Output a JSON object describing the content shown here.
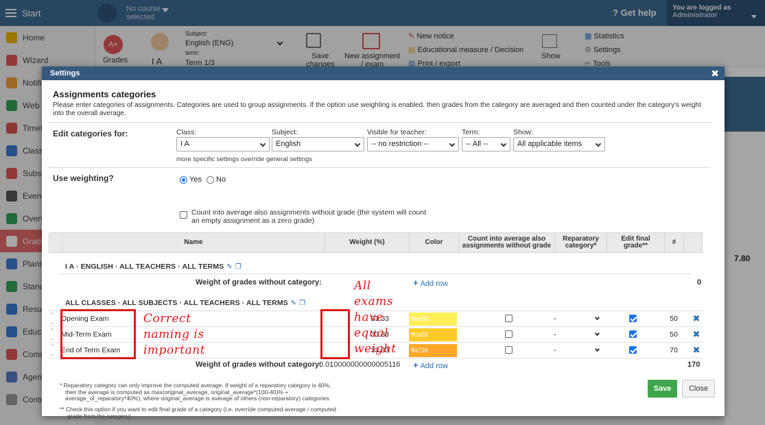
{
  "topbar": {
    "start": "Start",
    "course_line1": "No course",
    "course_line2": "selected",
    "get_help": "Get help",
    "logged_line1": "You are logged as",
    "logged_line2": "Administrator"
  },
  "sidebar": {
    "items": [
      {
        "label": "Home",
        "color": "#f2b400"
      },
      {
        "label": "Wizard",
        "color": "#e05757"
      },
      {
        "label": "Notifi",
        "color": "#f2a13a"
      },
      {
        "label": "Web p",
        "color": "#35a35a"
      },
      {
        "label": "Timeta",
        "color": "#d9534f"
      },
      {
        "label": "Class",
        "color": "#3a7bd5"
      },
      {
        "label": "Substi",
        "color": "#e05757"
      },
      {
        "label": "Event",
        "color": "#555555"
      },
      {
        "label": "Overv",
        "color": "#35a35a"
      },
      {
        "label": "Grade",
        "color": "#ffffff"
      },
      {
        "label": "Plans",
        "color": "#3a7bd5"
      },
      {
        "label": "Stand",
        "color": "#35a35a"
      },
      {
        "label": "Resul",
        "color": "#3a7bd5"
      },
      {
        "label": "Educa",
        "color": "#3a7bd5"
      },
      {
        "label": "Comm",
        "color": "#e05757"
      },
      {
        "label": "Agen",
        "color": "#5a78c8"
      },
      {
        "label": "Contr",
        "color": "#999999"
      }
    ]
  },
  "toolbar": {
    "grades": "Grades",
    "subject_label": "Subject:",
    "subject_value": "English (ENG)",
    "term_label": "term:",
    "class_short": "I A",
    "term_value": "Term 1/3",
    "save_line1": "Save",
    "save_line2": "changes",
    "new_assignment_line1": "New assignment",
    "new_assignment_line2": "/ exam",
    "new_notice": "New notice",
    "educational_measure": "Educational measure / Decision",
    "print_export": "Print / export",
    "show": "Show",
    "statistics": "Statistics",
    "settings": "Settings",
    "tools": "Tools"
  },
  "background": {
    "value_780": "7.80"
  },
  "dialog": {
    "title": "Settings",
    "section_title": "Assignments categories",
    "description": "Please enter categories of assignments. Categories are used to group assignments. If the option use weighting is enabled, then grades from the category are averaged and then counted under the category's weight into the overall average.",
    "edit_for": "Edit categories for:",
    "filters": {
      "class_label": "Class:",
      "class_value": "I A",
      "subject_label": "Subject:",
      "subject_value": "English",
      "visible_label": "Visible for teacher:",
      "visible_value": "-- no restriction --",
      "term_label": "Term:",
      "term_value": "-- All --",
      "show_label": "Show:",
      "show_value": "All applicable items",
      "note": "more specific settings override general settings"
    },
    "weighting": {
      "label": "Use weighting?",
      "yes": "Yes",
      "no": "No",
      "count_line1": "Count into average also assignments without grade (the system will count",
      "count_line2": "an empty assignment as a zero grade)"
    },
    "table": {
      "headers": {
        "name": "Name",
        "weight": "Weight (%)",
        "color": "Color",
        "count1": "Count into average also",
        "count2": "assignments without grade",
        "rep1": "Reparatory",
        "rep2": "category*",
        "edit1": "Edit final",
        "edit2": "grade**",
        "hash": "#"
      },
      "group1": "I A · ENGLISH · ALL TEACHERS · ALL TERMS",
      "group1_sum_label": "Weight of grades without category:",
      "group1_sum_value": "0",
      "group2": "ALL CLASSES · ALL SUBJECTS · ALL TEACHERS · ALL TERMS",
      "group2_sum_label": "Weight of grades without category:",
      "group2_sum_value": "0.010000000000005116",
      "group2_total": "170",
      "add_row": "Add row",
      "rows": [
        {
          "name": "Opening Exam",
          "weight": "33.33",
          "color": "#ffee58",
          "color_text": "ffee58",
          "reparatory": "-",
          "number": "50"
        },
        {
          "name": "Mid-Term Exam",
          "weight": "33.33",
          "color": "#ffca28",
          "color_text": "ffca28",
          "reparatory": "-",
          "number": "50"
        },
        {
          "name": "End of Term Exam",
          "weight": "33.33",
          "color": "#ffa726",
          "color_text": "ffa726",
          "reparatory": "-",
          "number": "70"
        }
      ]
    },
    "annotations": {
      "left": [
        "Correct",
        "naming is",
        "important"
      ],
      "right": [
        "All",
        "exams",
        "have",
        "equal",
        "weight"
      ]
    },
    "footnotes": {
      "f1_l1": "* Reparatory category can only improve the computed average. If weight of a reparatory category is 40%,",
      "f1_l2": "then the average is computed as max(original_average, original_average*(100-40)% +",
      "f1_l3": "average_of_reparatory*40%), where original_average is average of others (non-reparatory) categories.",
      "f2_l1": "** Check this option if you want to edit final grade of a category (i.e. override computed average / computed",
      "f2_l2": "grade from the category)"
    },
    "buttons": {
      "save": "Save",
      "close": "Close"
    }
  }
}
